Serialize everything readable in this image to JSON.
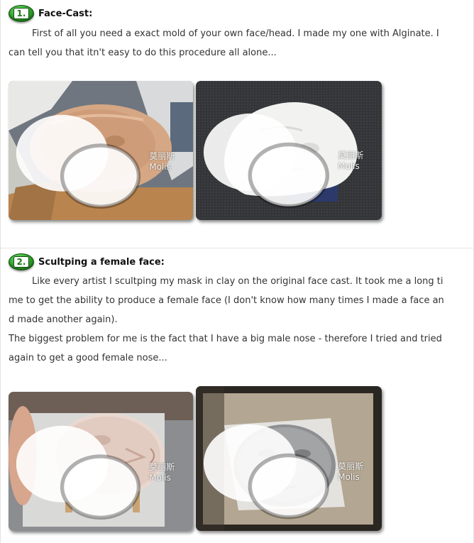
{
  "sections": [
    {
      "number": "1.",
      "title": "Face-Cast:",
      "lines": [
        "        First of all you need a exact mold of your own face/head. I made my one with Alginate. I",
        "can tell you that itn't easy to do this procedure all alone..."
      ],
      "photos": [
        {
          "watermark": "莫丽斯Molis",
          "subject": "alginate mold on newspaper"
        },
        {
          "watermark": "莫丽斯Molis",
          "subject": "white plaster face cast"
        }
      ]
    },
    {
      "number": "2.",
      "title": "Scultping a female face:",
      "lines": [
        "        Like every artist I scultping my mask in clay on the original face cast. It took me a long ti",
        "me to get the ability to produce a female face (I don't know how many times I made a face an",
        "d made another again).",
        "The biggest problem for me is the fact that I have a big male nose - therefore I tried and tried",
        "again to get a good female nose..."
      ],
      "photos": [
        {
          "watermark": "莫丽斯Molis",
          "subject": "clay female face on board"
        },
        {
          "watermark": "莫丽斯Molis",
          "subject": "grey sculpted face on paper"
        }
      ]
    }
  ],
  "colors": {
    "badge_green": "#2fa02a",
    "text": "#333333",
    "title": "#111111"
  },
  "icons": {
    "watermark": "wechat-icon"
  }
}
